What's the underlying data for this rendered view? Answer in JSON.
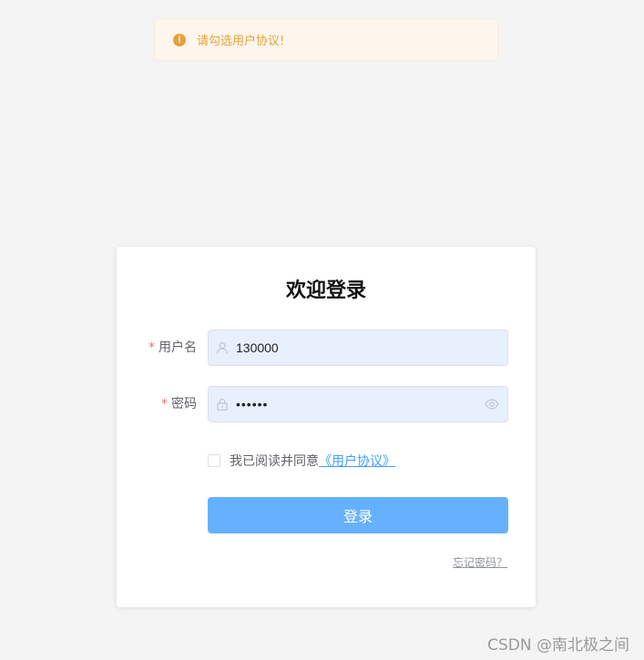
{
  "toast": {
    "type": "warning",
    "message": "请勾选用户协议!",
    "icon": "exclamation-circle-icon",
    "color": "#e6a23c"
  },
  "login": {
    "title": "欢迎登录",
    "username": {
      "label": "用户名",
      "required": "*",
      "value": "130000",
      "icon": "user-icon"
    },
    "password": {
      "label": "密码",
      "required": "*",
      "value": "••••••",
      "icon": "lock-icon",
      "toggle_icon": "eye-icon"
    },
    "agreement": {
      "checked": false,
      "text": "我已阅读并同意",
      "link": "《用户协议》"
    },
    "submit_label": "登录",
    "forgot_label": "忘记密码？",
    "accent_color": "#66b1ff",
    "required_color": "#f56c6c"
  },
  "watermark": "CSDN @南北极之间"
}
